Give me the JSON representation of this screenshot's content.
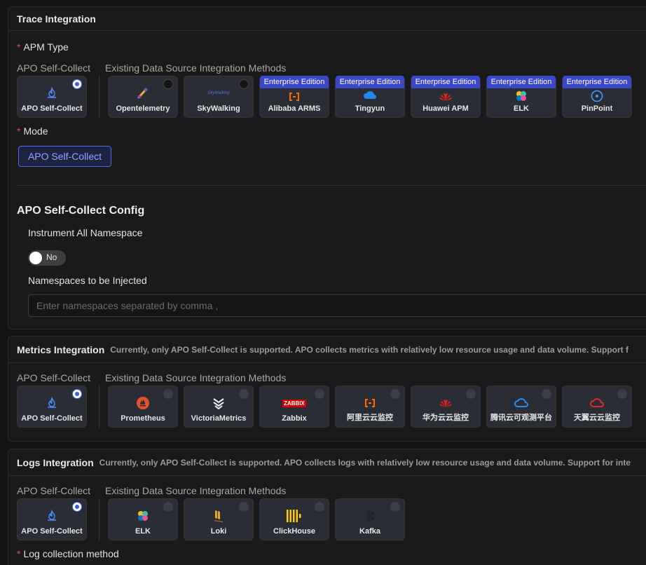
{
  "trace": {
    "title": "Trace Integration",
    "apm_label": "APM Type",
    "self_label": "APO Self-Collect",
    "existing_label": "Existing Data Source Integration Methods",
    "badge": "Enterprise Edition",
    "self_card": "APO Self-Collect",
    "cards": [
      "Opentelemetry",
      "SkyWalking",
      "Alibaba ARMS",
      "Tingyun",
      "Huawei APM",
      "ELK",
      "PinPoint"
    ],
    "skywalking_logo": "SkyWalking",
    "mode_label": "Mode",
    "mode_value": "APO Self-Collect",
    "config_title": "APO Self-Collect Config",
    "instrument_label": "Instrument All Namespace",
    "toggle_text": "No",
    "namespaces_label": "Namespaces to be Injected",
    "namespaces_placeholder": "Enter namespaces separated by comma ,"
  },
  "metrics": {
    "title": "Metrics Integration",
    "note": "Currently, only APO Self-Collect is supported. APO collects metrics with relatively low resource usage and data volume. Support f",
    "self_label": "APO Self-Collect",
    "existing_label": "Existing Data Source Integration Methods",
    "self_card": "APO Self-Collect",
    "cards": [
      "Prometheus",
      "VictoriaMetrics",
      "Zabbix",
      "阿里云云监控",
      "华为云云监控",
      "腾讯云可观测平台",
      "天翼云云监控"
    ],
    "zabbix_logo": "ZABBIX"
  },
  "logs": {
    "title": "Logs Integration",
    "note": "Currently, only APO Self-Collect is supported. APO collects logs with relatively low resource usage and data volume. Support for inte",
    "self_label": "APO Self-Collect",
    "existing_label": "Existing Data Source Integration Methods",
    "self_card": "APO Self-Collect",
    "cards": [
      "ELK",
      "Loki",
      "ClickHouse",
      "Kafka"
    ],
    "method_label": "Log collection method"
  },
  "colors": {
    "accent": "#3b5bdb",
    "badge": "#3848c8",
    "required": "#e5484d",
    "card": "#2a2d35"
  },
  "icons": {
    "apo": "flame-icon",
    "opentelemetry": "telescope-icon",
    "skywalking": "skywalking-logo",
    "alibaba": "alibaba-cloud-icon",
    "tingyun": "tingyun-cloud-icon",
    "huawei": "huawei-icon",
    "elk": "elastic-icon",
    "pinpoint": "pinpoint-icon",
    "prometheus": "prometheus-icon",
    "victoriametrics": "victoriametrics-icon",
    "zabbix": "zabbix-logo",
    "tencent": "tencent-cloud-icon",
    "tianyi": "tianyi-cloud-icon",
    "loki": "loki-icon",
    "clickhouse": "clickhouse-icon",
    "kafka": "kafka-icon"
  }
}
